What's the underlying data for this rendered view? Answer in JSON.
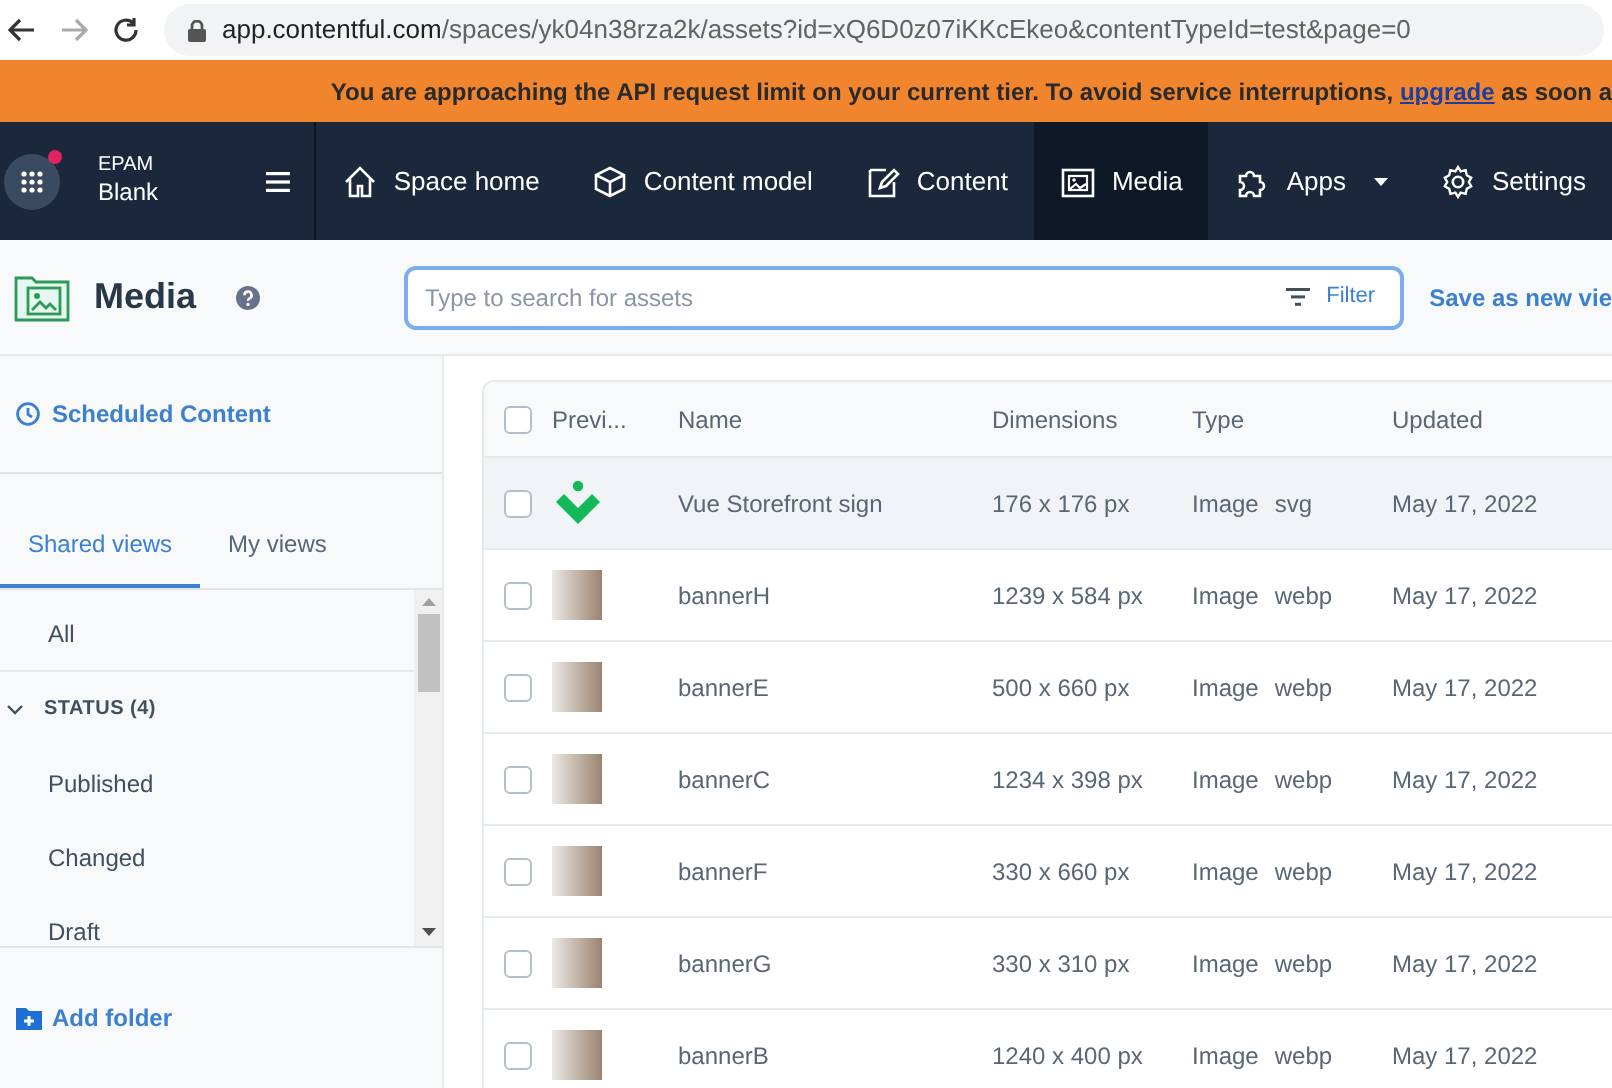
{
  "browser": {
    "url_host": "app.contentful.com",
    "url_path": "/spaces/yk04n38rza2k/assets?id=xQ6D0z07iKKcEkeo&contentTypeId=test&page=0"
  },
  "banner": {
    "text": "You are approaching the API request limit on your current tier. To avoid service interruptions, ",
    "link": "upgrade",
    "text_after": " as soon a"
  },
  "space": {
    "org": "EPAM",
    "name": "Blank",
    "notification": true
  },
  "nav": [
    {
      "label": "Space home",
      "selected": false,
      "dropdown": false
    },
    {
      "label": "Content model",
      "selected": false,
      "dropdown": false
    },
    {
      "label": "Content",
      "selected": false,
      "dropdown": false
    },
    {
      "label": "Media",
      "selected": true,
      "dropdown": false
    },
    {
      "label": "Apps",
      "selected": false,
      "dropdown": true
    },
    {
      "label": "Settings",
      "selected": false,
      "dropdown": false
    }
  ],
  "page": {
    "title": "Media",
    "search_placeholder": "Type to search for assets",
    "filter": "Filter",
    "save_view": "Save as new vie"
  },
  "sidebar": {
    "scheduled": "Scheduled Content",
    "tabs": [
      {
        "label": "Shared views",
        "selected": true
      },
      {
        "label": "My views",
        "selected": false
      }
    ],
    "items": [
      {
        "kind": "view",
        "label": "All"
      },
      {
        "kind": "group",
        "label": "STATUS (4)",
        "expanded": true
      },
      {
        "kind": "view",
        "label": "Published"
      },
      {
        "kind": "view",
        "label": "Changed"
      },
      {
        "kind": "view",
        "label": "Draft"
      }
    ],
    "add_folder": "Add folder"
  },
  "table": {
    "select_all_checked": false,
    "columns": [
      "Previ...",
      "Name",
      "Dimensions",
      "Type",
      "Updated"
    ],
    "rows": [
      {
        "kind": "logo",
        "name": "Vue Storefront sign",
        "dimensions": "176 x 176 px",
        "type": "Image",
        "format": "svg",
        "updated": "May 17, 2022",
        "checked": false,
        "hovered": true
      },
      {
        "kind": "photo",
        "name": "bannerH",
        "dimensions": "1239 x 584 px",
        "type": "Image",
        "format": "webp",
        "updated": "May 17, 2022",
        "checked": false,
        "hovered": false
      },
      {
        "kind": "photo",
        "name": "bannerE",
        "dimensions": "500 x 660 px",
        "type": "Image",
        "format": "webp",
        "updated": "May 17, 2022",
        "checked": false,
        "hovered": false
      },
      {
        "kind": "photo",
        "name": "bannerC",
        "dimensions": "1234 x 398 px",
        "type": "Image",
        "format": "webp",
        "updated": "May 17, 2022",
        "checked": false,
        "hovered": false
      },
      {
        "kind": "photo",
        "name": "bannerF",
        "dimensions": "330 x 660 px",
        "type": "Image",
        "format": "webp",
        "updated": "May 17, 2022",
        "checked": false,
        "hovered": false
      },
      {
        "kind": "photo",
        "name": "bannerG",
        "dimensions": "330 x 310 px",
        "type": "Image",
        "format": "webp",
        "updated": "May 17, 2022",
        "checked": false,
        "hovered": false
      },
      {
        "kind": "photo",
        "name": "bannerB",
        "dimensions": "1240 x 400 px",
        "type": "Image",
        "format": "webp",
        "updated": "May 17, 2022",
        "checked": false,
        "hovered": false
      }
    ]
  }
}
